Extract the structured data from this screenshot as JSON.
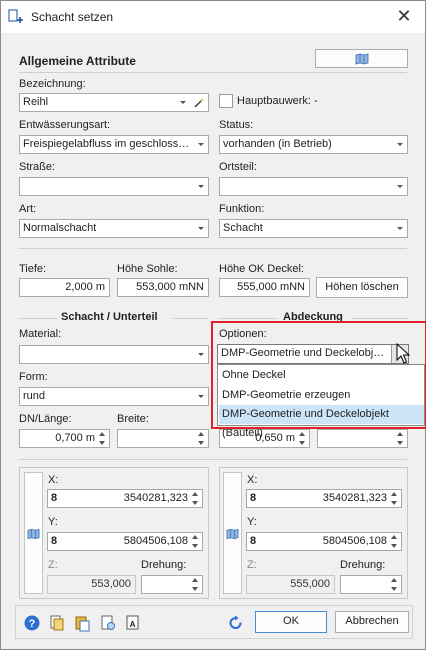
{
  "window": {
    "title": "Schacht setzen",
    "close_glyph": "✕"
  },
  "general": {
    "section_title": "Allgemeine Attribute",
    "bezeichnung_label": "Bezeichnung:",
    "bezeichnung_value": "Reihl",
    "hauptbauwerk_label": "Hauptbauwerk: -",
    "entwaesserung_label": "Entwässerungsart:",
    "entwaesserung_value": "Freispiegelabfluss im geschlosse...",
    "status_label": "Status:",
    "status_value": "vorhanden (in Betrieb)",
    "strasse_label": "Straße:",
    "strasse_value": "",
    "ortsteil_label": "Ortsteil:",
    "ortsteil_value": "",
    "art_label": "Art:",
    "art_value": "Normalschacht",
    "funktion_label": "Funktion:",
    "funktion_value": "Schacht"
  },
  "heights": {
    "tiefe_label": "Tiefe:",
    "tiefe_value": "2,000 m",
    "sohle_label": "Höhe Sohle:",
    "sohle_value": "553,000 mNN",
    "deckel_label": "Höhe OK Deckel:",
    "deckel_value": "555,000 mNN",
    "clear_button": "Höhen löschen"
  },
  "schacht": {
    "section_title": "Schacht / Unterteil",
    "material_label": "Material:",
    "material_value": "",
    "form_label": "Form:",
    "form_value": "rund",
    "dn_label": "DN/Länge:",
    "dn_value": "0,700 m",
    "breite_label": "Breite:",
    "breite_value": ""
  },
  "abdeckung": {
    "section_title": "Abdeckung",
    "optionen_label": "Optionen:",
    "optionen_value": "DMP-Geometrie und Deckelobjek...",
    "dn_value": "0,650 m",
    "dropdown_options": [
      "Ohne Deckel",
      "DMP-Geometrie erzeugen",
      "DMP-Geometrie und Deckelobjekt (Bauteil)"
    ]
  },
  "coords_left": {
    "x_label": "X:",
    "x_code": "8",
    "x_value": "3540281,323",
    "y_label": "Y:",
    "y_code": "8",
    "y_value": "5804506,108",
    "z_label": "Z:",
    "z_value": "553,000",
    "drehung_label": "Drehung:",
    "drehung_value": ""
  },
  "coords_right": {
    "x_label": "X:",
    "x_code": "8",
    "x_value": "3540281,323",
    "y_label": "Y:",
    "y_code": "8",
    "y_value": "5804506,108",
    "z_label": "Z:",
    "z_value": "555,000",
    "drehung_label": "Drehung:",
    "drehung_value": ""
  },
  "footer": {
    "ok_label": "OK",
    "cancel_label": "Abbrechen"
  },
  "colors": {
    "accent": "#4a88d8",
    "highlight": "#cce4f7",
    "red_outline": "#e0202a"
  }
}
